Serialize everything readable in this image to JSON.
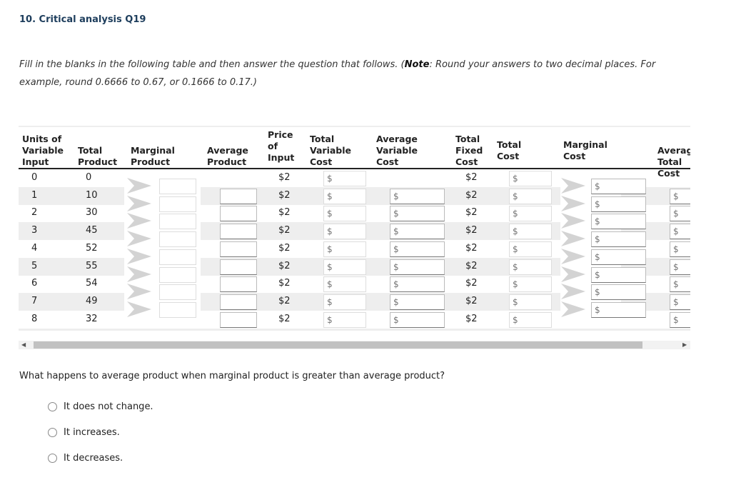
{
  "title": "10. Critical analysis Q19",
  "instructions": {
    "prefix": "Fill in the blanks in the following table and then answer the question that follows. (",
    "note_label": "Note",
    "suffix": ": Round your answers to two decimal places. For example, round 0.6666 to 0.67, or 0.1666 to 0.17.)"
  },
  "table": {
    "headers": {
      "units": [
        "Units of",
        "Variable",
        "Input"
      ],
      "tp": [
        "Total",
        "Product"
      ],
      "mp": [
        "Marginal",
        "Product"
      ],
      "ap": [
        "Average",
        "Product"
      ],
      "price": [
        "Price",
        "of",
        "Input"
      ],
      "tvc": [
        "Total",
        "Variable",
        "Cost"
      ],
      "avc": [
        "Average",
        "Variable",
        "Cost"
      ],
      "tfc": [
        "Total",
        "Fixed",
        "Cost"
      ],
      "tc": [
        "Total",
        "Cost"
      ],
      "mc": [
        "Marginal",
        "Cost"
      ],
      "atc": [
        "Average",
        "Total Cost"
      ]
    },
    "rows": [
      {
        "units": "0",
        "tp": "0",
        "price": "$2",
        "tfc": "$2"
      },
      {
        "units": "1",
        "tp": "10",
        "price": "$2",
        "tfc": "$2"
      },
      {
        "units": "2",
        "tp": "30",
        "price": "$2",
        "tfc": "$2"
      },
      {
        "units": "3",
        "tp": "45",
        "price": "$2",
        "tfc": "$2"
      },
      {
        "units": "4",
        "tp": "52",
        "price": "$2",
        "tfc": "$2"
      },
      {
        "units": "5",
        "tp": "55",
        "price": "$2",
        "tfc": "$2"
      },
      {
        "units": "6",
        "tp": "54",
        "price": "$2",
        "tfc": "$2"
      },
      {
        "units": "7",
        "tp": "49",
        "price": "$2",
        "tfc": "$2"
      },
      {
        "units": "8",
        "tp": "32",
        "price": "$2",
        "tfc": "$2"
      }
    ],
    "dollar_placeholder": "$"
  },
  "question": "What happens to average product when marginal product is greater than average product?",
  "options": [
    "It does not change.",
    "It increases.",
    "It decreases."
  ]
}
